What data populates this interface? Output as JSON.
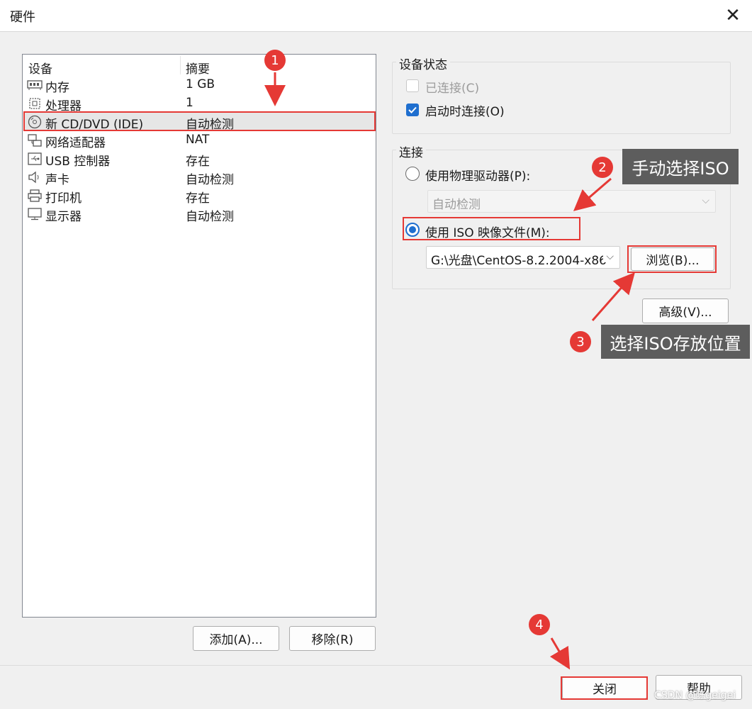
{
  "window": {
    "title": "硬件"
  },
  "device_list": {
    "columns": [
      "设备",
      "摘要"
    ],
    "rows": [
      {
        "name": "内存",
        "summary": "1 GB",
        "icon": "memory-icon"
      },
      {
        "name": "处理器",
        "summary": "1",
        "icon": "processor-icon"
      },
      {
        "name": "新 CD/DVD (IDE)",
        "summary": "自动检测",
        "icon": "cd-dvd-icon",
        "selected": true
      },
      {
        "name": "网络适配器",
        "summary": "NAT",
        "icon": "network-adapter-icon"
      },
      {
        "name": "USB 控制器",
        "summary": "存在",
        "icon": "usb-icon"
      },
      {
        "name": "声卡",
        "summary": "自动检测",
        "icon": "speaker-icon"
      },
      {
        "name": "打印机",
        "summary": "存在",
        "icon": "printer-icon"
      },
      {
        "name": "显示器",
        "summary": "自动检测",
        "icon": "monitor-icon"
      }
    ]
  },
  "buttons": {
    "add": "添加(A)...",
    "remove": "移除(R)",
    "browse": "浏览(B)...",
    "advanced": "高级(V)...",
    "close": "关闭",
    "help": "帮助"
  },
  "device_status": {
    "label": "设备状态",
    "connected": {
      "label": "已连接(C)",
      "checked": false,
      "disabled": true
    },
    "connect_at_power_on": {
      "label": "启动时连接(O)",
      "checked": true
    }
  },
  "connection": {
    "label": "连接",
    "physical_drive": {
      "label": "使用物理驱动器(P):",
      "selected": false
    },
    "physical_drive_select": "自动检测",
    "iso_image": {
      "label": "使用 ISO 映像文件(M):",
      "selected": true
    },
    "iso_path": "G:\\光盘\\CentOS-8.2.2004-x86"
  },
  "annotations": {
    "step1": "1",
    "step2": "2",
    "step2_text": "手动选择ISO",
    "step3": "3",
    "step3_text": "选择ISO存放位置",
    "step4": "4"
  },
  "watermark": "CSDN @陈geigei",
  "colors": {
    "accent": "#1f6fcf",
    "annotation_red": "#e53935",
    "callout_bg": "#5d5d5d"
  }
}
